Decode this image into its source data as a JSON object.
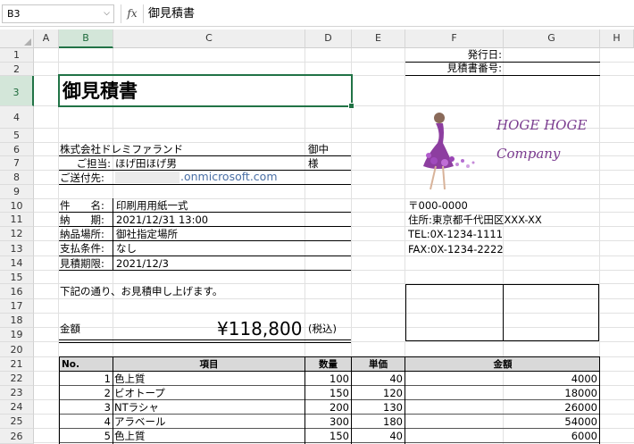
{
  "formula_bar": {
    "name_box": "B3",
    "fx": "fx",
    "formula": "御見積書"
  },
  "columns": [
    "A",
    "B",
    "C",
    "D",
    "E",
    "F",
    "G",
    "H"
  ],
  "rows": [
    "1",
    "2",
    "3",
    "4",
    "5",
    "6",
    "7",
    "8",
    "9",
    "10",
    "11",
    "12",
    "13",
    "14",
    "15",
    "16",
    "17",
    "18",
    "19",
    "20",
    "21",
    "22",
    "23",
    "24",
    "25",
    "26"
  ],
  "selected_cell": "B3",
  "doc": {
    "issue_date_label": "発行日:",
    "quote_no_label": "見積書番号:",
    "title": "御見積書",
    "client_company": "株式会社ドレミファランド",
    "onchu": "御中",
    "contact_label": "ご担当:",
    "contact_name": "ほげ田ほげ男",
    "sama": "様",
    "send_to_label": "ご送付先:",
    "email_domain": ".onmicrosoft.com",
    "subject_label": "件　　名:",
    "subject": "印刷用用紙一式",
    "deadline_label": "納　　期:",
    "deadline": "2021/12/31 13:00",
    "delivery_label": "納品場所:",
    "delivery": "御社指定場所",
    "payment_label": "支払条件:",
    "payment": "なし",
    "validity_label": "見積期限:",
    "validity": "2021/12/3",
    "message": "下記の通り、お見積申し上げます。",
    "amount_label": "金額",
    "amount": "¥118,800",
    "tax_note": "(税込)"
  },
  "company": {
    "logo_line1": "HOGE HOGE",
    "logo_line2": "Company",
    "postal": "〒000-0000",
    "address": "住所:東京都千代田区XXX-XX",
    "tel": "TEL:0X-1234-1111",
    "fax": "FAX:0X-1234-2222"
  },
  "table": {
    "headers": [
      "No.",
      "項目",
      "数量",
      "単価",
      "金額"
    ],
    "rows": [
      [
        "1",
        "色上質",
        "100",
        "40",
        "4000"
      ],
      [
        "2",
        "ビオトープ",
        "150",
        "120",
        "18000"
      ],
      [
        "3",
        "NTラシャ",
        "200",
        "130",
        "26000"
      ],
      [
        "4",
        "アラベール",
        "300",
        "180",
        "54000"
      ],
      [
        "5",
        "色上質",
        "150",
        "40",
        "6000"
      ]
    ]
  }
}
